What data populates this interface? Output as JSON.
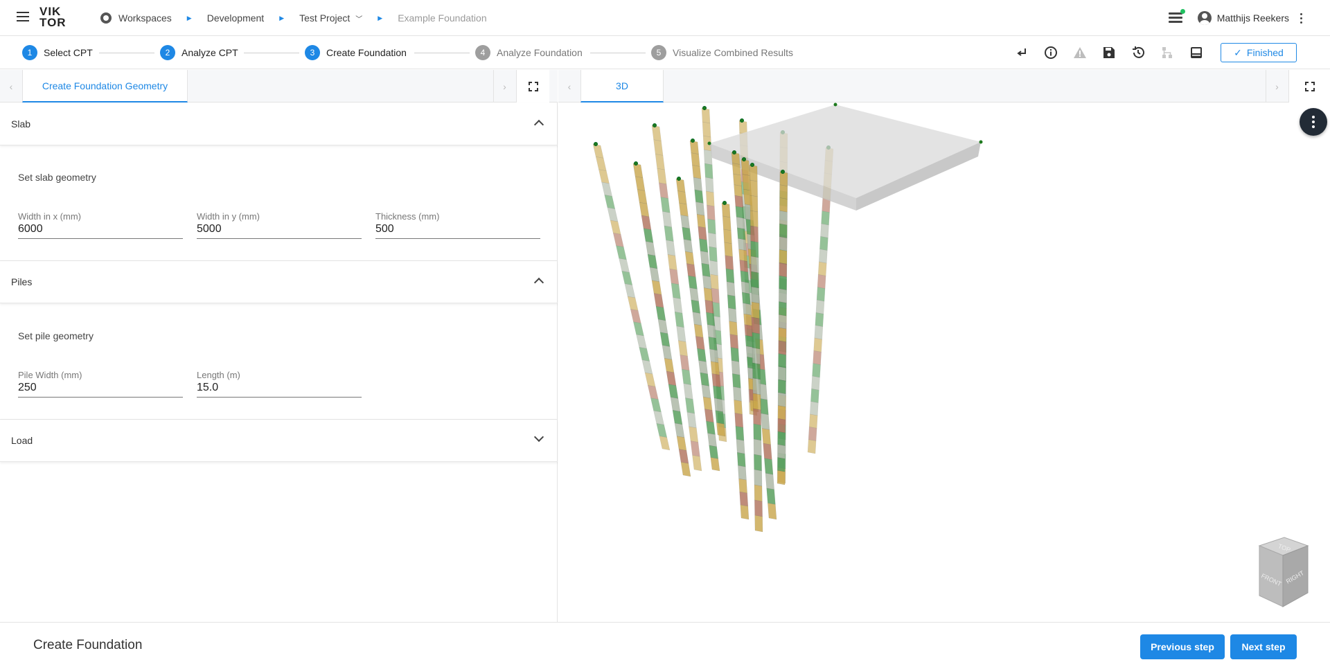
{
  "app": {
    "logo_top": "VIK",
    "logo_bottom": "TOR"
  },
  "breadcrumbs": [
    {
      "label": "Workspaces"
    },
    {
      "label": "Development"
    },
    {
      "label": "Test Project"
    },
    {
      "label": "Example Foundation"
    }
  ],
  "user": {
    "name": "Matthijs Reekers"
  },
  "steps": [
    {
      "num": "1",
      "label": "Select CPT",
      "state": "done"
    },
    {
      "num": "2",
      "label": "Analyze CPT",
      "state": "done"
    },
    {
      "num": "3",
      "label": "Create Foundation",
      "state": "current"
    },
    {
      "num": "4",
      "label": "Analyze Foundation",
      "state": "todo"
    },
    {
      "num": "5",
      "label": "Visualize Combined Results",
      "state": "todo"
    }
  ],
  "toolbar": {
    "finished_label": "Finished"
  },
  "left_tab": {
    "label": "Create Foundation Geometry"
  },
  "slab": {
    "title": "Slab",
    "subtitle": "Set slab geometry",
    "fields": [
      {
        "label": "Width in x (mm)",
        "value": "6000"
      },
      {
        "label": "Width in y (mm)",
        "value": "5000"
      },
      {
        "label": "Thickness (mm)",
        "value": "500"
      }
    ]
  },
  "piles": {
    "title": "Piles",
    "subtitle": "Set pile geometry",
    "fields": [
      {
        "label": "Pile Width (mm)",
        "value": "250"
      },
      {
        "label": "Length (m)",
        "value": "15.0"
      }
    ]
  },
  "load": {
    "title": "Load"
  },
  "right_tab": {
    "label": "3D"
  },
  "viewcube": {
    "top": "TOP",
    "front": "FRONT",
    "right": "RIGHT"
  },
  "footer": {
    "title": "Create Foundation",
    "prev_label": "Previous step",
    "next_label": "Next step"
  },
  "colors": {
    "accent": "#1e88e5",
    "sand": "#c9a64a",
    "clay": "#b0705a",
    "peat": "#4f9a55",
    "silt": "#a9b5a2"
  }
}
